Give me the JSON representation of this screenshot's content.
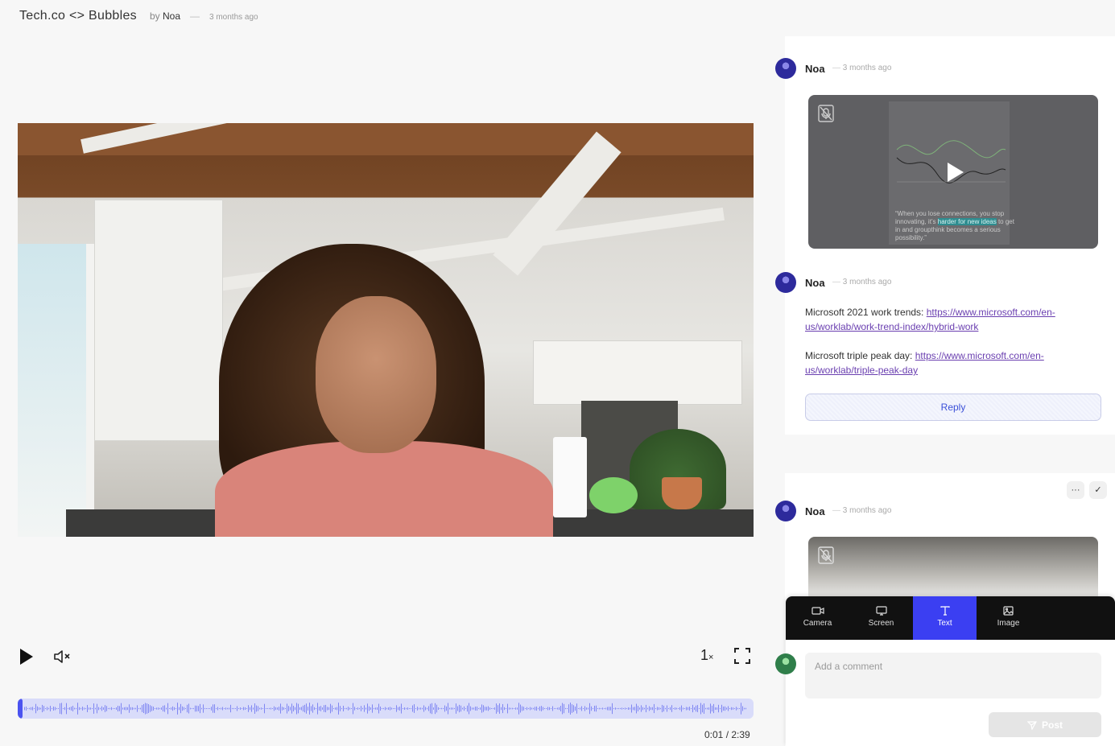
{
  "header": {
    "title": "Tech.co <> Bubbles",
    "by_label": "by",
    "author": "Noa",
    "dash": "—",
    "time": "3 months ago"
  },
  "player": {
    "speed": "1",
    "speed_suffix": "×",
    "time": "0:01 / 2:39",
    "progress": 0.006
  },
  "comments": [
    {
      "author": "Noa",
      "time": "3 months ago",
      "type": "screen",
      "quote_pre": "“When you lose connections, you stop innovating, it’s ",
      "quote_hl": "harder for new ideas",
      "quote_post": " to get in and groupthink becomes a serious possibility.”"
    },
    {
      "author": "Noa",
      "time": "3 months ago",
      "type": "text",
      "line1_label": "Microsoft 2021 work trends: ",
      "line1_link": "https://www.microsoft.com/en-us/worklab/work-trend-index/hybrid-work",
      "line2_label": "Microsoft triple peak day: ",
      "line2_link": "https://www.microsoft.com/en-us/worklab/triple-peak-day"
    },
    {
      "author": "Noa",
      "time": "3 months ago",
      "type": "camera"
    }
  ],
  "reply_label": "Reply",
  "thread_actions": {
    "more": "···",
    "resolve": "✓"
  },
  "composer": {
    "tabs": [
      {
        "label": "Camera",
        "icon": "camera-icon"
      },
      {
        "label": "Screen",
        "icon": "monitor-icon"
      },
      {
        "label": "Text",
        "icon": "text-icon"
      },
      {
        "label": "Image",
        "icon": "image-icon"
      }
    ],
    "active_tab": "Text",
    "placeholder": "Add a comment",
    "post_label": "Post"
  },
  "colors": {
    "accent": "#3b3ff2",
    "waveform_bg": "#d9dcfa",
    "waveform_bar": "#7f86f2",
    "link": "#6a3fb0"
  }
}
